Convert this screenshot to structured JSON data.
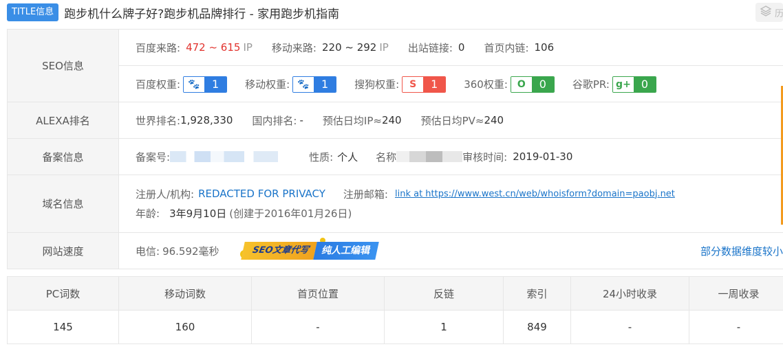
{
  "title": {
    "badge": "TITLE信息",
    "text": "跑步机什么牌子好?跑步机品牌排行 - 家用跑步机指南",
    "tool_label": "历"
  },
  "seo": {
    "label": "SEO信息",
    "baidu_traffic_label": "百度来路:",
    "baidu_traffic_value": "472 ~ 615",
    "ip_unit": "IP",
    "mobile_traffic_label": "移动来路:",
    "mobile_traffic_value": "220 ~ 292",
    "outbound_label": "出站链接:",
    "outbound_value": "0",
    "home_internal_label": "首页内链:",
    "home_internal_value": "106",
    "weights": [
      {
        "label": "百度权重:",
        "icon": "paw-icon",
        "glyph": "🐾",
        "value": "1",
        "color": "#2f7de1"
      },
      {
        "label": "移动权重:",
        "icon": "paw-icon",
        "glyph": "🐾",
        "value": "1",
        "color": "#2f7de1"
      },
      {
        "label": "搜狗权重:",
        "icon": "sogou-icon",
        "glyph": "S",
        "value": "1",
        "color": "#f0564a"
      },
      {
        "label": "360权重:",
        "icon": "360-icon",
        "glyph": "O",
        "value": "0",
        "color": "#3aa64d"
      },
      {
        "label": "谷歌PR:",
        "icon": "google-plus-icon",
        "glyph": "g+",
        "value": "0",
        "color": "#3aa64d"
      }
    ]
  },
  "alexa": {
    "label": "ALEXA排名",
    "world_label": "世界排名:",
    "world_value": "1,928,330",
    "domestic_label": "国内排名:",
    "domestic_value": "-",
    "ip_label": "预估日均IP≈",
    "ip_value": "240",
    "pv_label": "预估日均PV≈",
    "pv_value": "240"
  },
  "beian": {
    "label": "备案信息",
    "number_label": "备案号:",
    "nature_label": "性质:",
    "nature_value": "个人",
    "name_label": "名称",
    "audit_label": "审核时间:",
    "audit_value": "2019-01-30"
  },
  "domain": {
    "label": "域名信息",
    "registrant_label": "注册人/机构:",
    "registrant_value": "REDACTED FOR PRIVACY",
    "email_label": "注册邮箱:",
    "email_value": "link at https://www.west.cn/web/whoisform?domain=paobj.net",
    "age_label": "年龄:",
    "age_value": "3年9月10日",
    "created_value": "(创建于2016年01月26日)"
  },
  "speed": {
    "label": "网站速度",
    "telecom_label": "电信:",
    "telecom_value": "96.592毫秒",
    "ad_left": "SEO文章代写",
    "ad_right": "纯人工编辑",
    "note": "部分数据维度较小"
  },
  "stats": {
    "headers": [
      "PC词数",
      "移动词数",
      "首页位置",
      "反链",
      "索引",
      "24小时收录",
      "一周收录"
    ],
    "values": [
      "145",
      "160",
      "-",
      "1",
      "849",
      "-",
      "-"
    ]
  }
}
